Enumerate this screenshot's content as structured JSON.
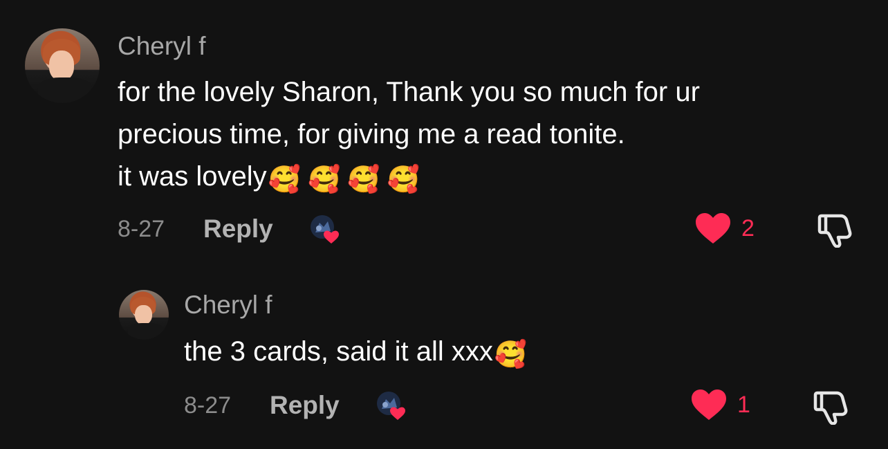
{
  "comments": [
    {
      "username": "Cheryl f",
      "lines": [
        "for the lovely Sharon, Thank you so much for ur",
        "precious time, for giving me a read tonite.",
        "it was lovely"
      ],
      "emojis": [
        "🥰",
        "🥰",
        "🥰",
        "🥰"
      ],
      "date": "8-27",
      "reply_label": "Reply",
      "like_count": "2",
      "like_color": "#fe2c55"
    },
    {
      "username": "Cheryl f",
      "lines": [
        "the 3 cards, said it all xxx"
      ],
      "emojis": [
        "🥰"
      ],
      "date": "8-27",
      "reply_label": "Reply",
      "like_count": "1",
      "like_color": "#fe2c55"
    }
  ],
  "icons": {
    "like": "heart-icon",
    "dislike": "thumbs-down-icon",
    "creator_liked": "creator-liked-badge-icon"
  }
}
